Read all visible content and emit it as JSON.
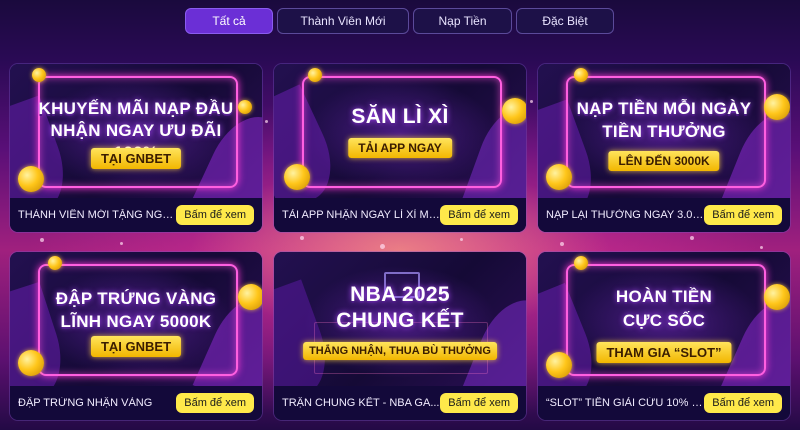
{
  "tabs": [
    {
      "label": "Tất cả",
      "active": true
    },
    {
      "label": "Thành Viên Mới",
      "active": false
    },
    {
      "label": "Nạp Tiền",
      "active": false
    },
    {
      "label": "Đặc Biệt",
      "active": false
    }
  ],
  "promos": [
    {
      "headline_1": "KHUYẾN MÃI NẠP ĐẦU",
      "headline_2": "NHẬN NGAY ƯU ĐÃI 100%",
      "badge": "TẠI GNBET",
      "title": "THÀNH VIÊN MỚI TẶNG NGA...",
      "button": "Bấm để xem"
    },
    {
      "headline_1": "SĂN LÌ XÌ",
      "headline_2": "",
      "badge": "TẢI APP NGAY",
      "title": "TẢI APP NHẬN NGAY LÌ XÌ MA...",
      "button": "Bấm để xem"
    },
    {
      "headline_1": "NẠP TIỀN MỖI NGÀY",
      "headline_2": "TIỀN THƯỞNG",
      "badge": "LÊN ĐẾN 3000K",
      "title": "NẠP LẠI THƯỞNG NGAY 3.00...",
      "button": "Bấm để xem"
    },
    {
      "headline_1": "ĐẬP TRỨNG VÀNG",
      "headline_2": "LĨNH NGAY 5000K",
      "badge": "TẠI GNBET",
      "title": "ĐẬP TRỨNG NHẬN VÀNG",
      "button": "Bấm để xem"
    },
    {
      "headline_1": "NBA 2025",
      "headline_2": "CHUNG KẾT",
      "badge": "THẮNG NHẬN, THUA BÙ THƯỞNG",
      "title": "TRẬN CHUNG KẾT - NBA GA...",
      "button": "Bấm để xem"
    },
    {
      "headline_1": "HOÀN TIỀN",
      "headline_2": "CỰC SỐC",
      "badge": "THAM GIA “SLOT”",
      "title": "“SLOT” TIỀN GIẢI CỨU 10% M...",
      "button": "Bấm để xem"
    }
  ],
  "colors": {
    "active_tab": "#6b2fd6",
    "button": "#ffe94a",
    "badge": "#f2b600",
    "neon": "#ff5fe0"
  }
}
